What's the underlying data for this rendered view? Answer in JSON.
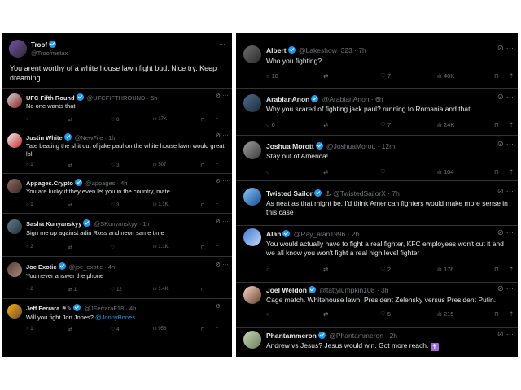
{
  "left": {
    "main_post": {
      "name": "Troof",
      "handle": "@Troofmetax",
      "text": "You arent worthy of a white house lawn fight bud. Nice try. Keep dreaming."
    },
    "replies": [
      {
        "name": "UFC Fifth Round",
        "handle": "@UFCFIFTHROUND",
        "time": "· 5h",
        "text": "No one wants that",
        "reply": "",
        "repost": "",
        "like": "8",
        "views": "17K"
      },
      {
        "name": "Justin White",
        "handle": "@NewFile",
        "time": "· 1h",
        "text": "Tate beating the shit out of jake paul on the white house lawn would great lol.",
        "reply": "1",
        "repost": "",
        "like": "3",
        "views": "507"
      },
      {
        "name": "Appages.Crypto",
        "handle": "@appages",
        "time": "· 4h",
        "text": "You are lucky if they even let you in the country, mate.",
        "reply": "1",
        "repost": "",
        "like": "3",
        "views": "1.1K"
      },
      {
        "name": "Sasha Kunyanskyy",
        "handle": "@SKunyanskyy",
        "time": "· 1h",
        "text": "Sign me up against adin Ross and neon same time",
        "reply": "2",
        "repost": "",
        "like": "",
        "views": "1.1K"
      },
      {
        "name": "Joe Exotic",
        "handle": "@joe_exotic",
        "time": "· 4h",
        "text": "You never answer the phone",
        "reply": "2",
        "repost": "1",
        "like": "12",
        "views": "1.4K"
      },
      {
        "name": "Jeff Ferrara",
        "handle": "@JFerraraF18",
        "time": "· 4h",
        "text_before": "Will you fight Jon Jones? ",
        "mention": "@JonnyBones",
        "reply": "1",
        "repost": "",
        "like": "4",
        "views": "958"
      }
    ]
  },
  "right": {
    "replies": [
      {
        "name": "Albert",
        "handle": "@Lakeshow_323",
        "time": "· 7h",
        "text": "Who you fighting?",
        "reply": "18",
        "repost": "",
        "like": "7",
        "views": "40K"
      },
      {
        "name": "ArabianAnon",
        "handle": "@ArabianAnon",
        "time": "· 6h",
        "text": "Why you scared of fighting jack paul? running to Romania and that",
        "reply": "6",
        "repost": "",
        "like": "7",
        "views": "24K"
      },
      {
        "name": "Joshua Morott",
        "handle": "@JoshuaMorott",
        "time": "· 12m",
        "text": "Stay out of America!",
        "reply": "",
        "repost": "",
        "like": "",
        "views": "104"
      },
      {
        "name": "Twisted Sailor",
        "handle": "@TwistedSailorX",
        "time": "· 7h",
        "text": "As neat as that might be, I'd think American fighters would make more sense in this case",
        "reply": "",
        "repost": "",
        "like": "",
        "views": ""
      },
      {
        "name": "Alan",
        "handle": "@Ray_alan1996",
        "time": "· 2h",
        "text": "You would actually have to fight a real fighter, KFC employees won't cut it and we all know you won't fight a real high level fighter",
        "reply": "",
        "repost": "",
        "like": "2",
        "views": "176"
      },
      {
        "name": "Joel Weldon",
        "handle": "@fattylumpkin108",
        "time": "· 3h",
        "text": "Cage match. Whitehouse lawn. President Zelensky versus President Putin.",
        "reply": "",
        "repost": "",
        "like": "5",
        "views": "215"
      },
      {
        "name": "Phantammeron",
        "handle": "@Phantammeron",
        "time": "· 2h",
        "text": "Andrew vs Jesus? Jesus would win. Got more reach.",
        "reply": "",
        "repost": "",
        "like": "",
        "views": ""
      }
    ]
  },
  "icons": {
    "reply": "speech-bubble-icon",
    "repost": "repost-icon",
    "like": "heart-icon",
    "views": "bar-chart-icon",
    "bookmark": "bookmark-icon",
    "share": "share-icon",
    "grok": "grok-icon",
    "more": "more-dots-icon",
    "verified": "verified-badge-icon"
  },
  "colors": {
    "background": "#000000",
    "text": "#e7e9ea",
    "muted": "#71767b",
    "accent": "#1d9bf0",
    "divider": "#2f3336"
  }
}
